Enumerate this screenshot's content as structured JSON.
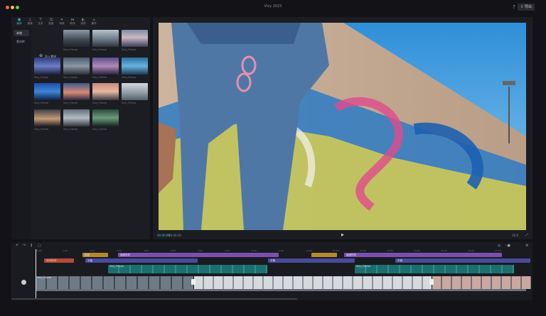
{
  "window": {
    "title": "Vixy 2023"
  },
  "colors": {
    "accent": "#31c0d8",
    "close": "#ec6a5e",
    "minimize": "#f4bf4f",
    "zoom": "#61c554"
  },
  "toolbar": {
    "help_icon": "help-icon",
    "export_label": "导出"
  },
  "media_tabs": [
    {
      "label": "媒体",
      "icon": "media-icon"
    },
    {
      "label": "音频",
      "icon": "audio-icon"
    },
    {
      "label": "文本",
      "icon": "text-icon"
    },
    {
      "label": "贴纸",
      "icon": "sticker-icon"
    },
    {
      "label": "特效",
      "icon": "effects-icon"
    },
    {
      "label": "转场",
      "icon": "transition-icon"
    },
    {
      "label": "滤镜",
      "icon": "filter-icon"
    },
    {
      "label": "素材",
      "icon": "material-icon"
    }
  ],
  "media_sidebar": [
    "本地",
    "素材库"
  ],
  "import_label": "导入素材",
  "thumb_caption": "Vixy_Frame",
  "preview": {
    "timecode_current": "00:00:00",
    "timecode_total": "00:00:20",
    "ratio": "16:9",
    "play_icon": "play-icon"
  },
  "timeline": {
    "ruler": [
      "00:00",
      "1:00",
      "2:00",
      "3:00",
      "4:00",
      "5:00",
      "6:00",
      "7:00",
      "8:00",
      "9:00",
      "10:00",
      "11:00",
      "12:00",
      "13:00",
      "14:00",
      "15:00",
      "16:00",
      "17:00",
      "18:00"
    ],
    "tracks": {
      "sticker1": "贴纸",
      "effect1": "画面特效",
      "effect2": "画面特效",
      "text_red": "VIXIEDIT",
      "text1": "字幕",
      "text2": "字幕",
      "text3": "字幕",
      "clip1": "Vixy_Frame",
      "clip2": "Vixy_Frame",
      "main": "Vixy_Frame"
    }
  }
}
